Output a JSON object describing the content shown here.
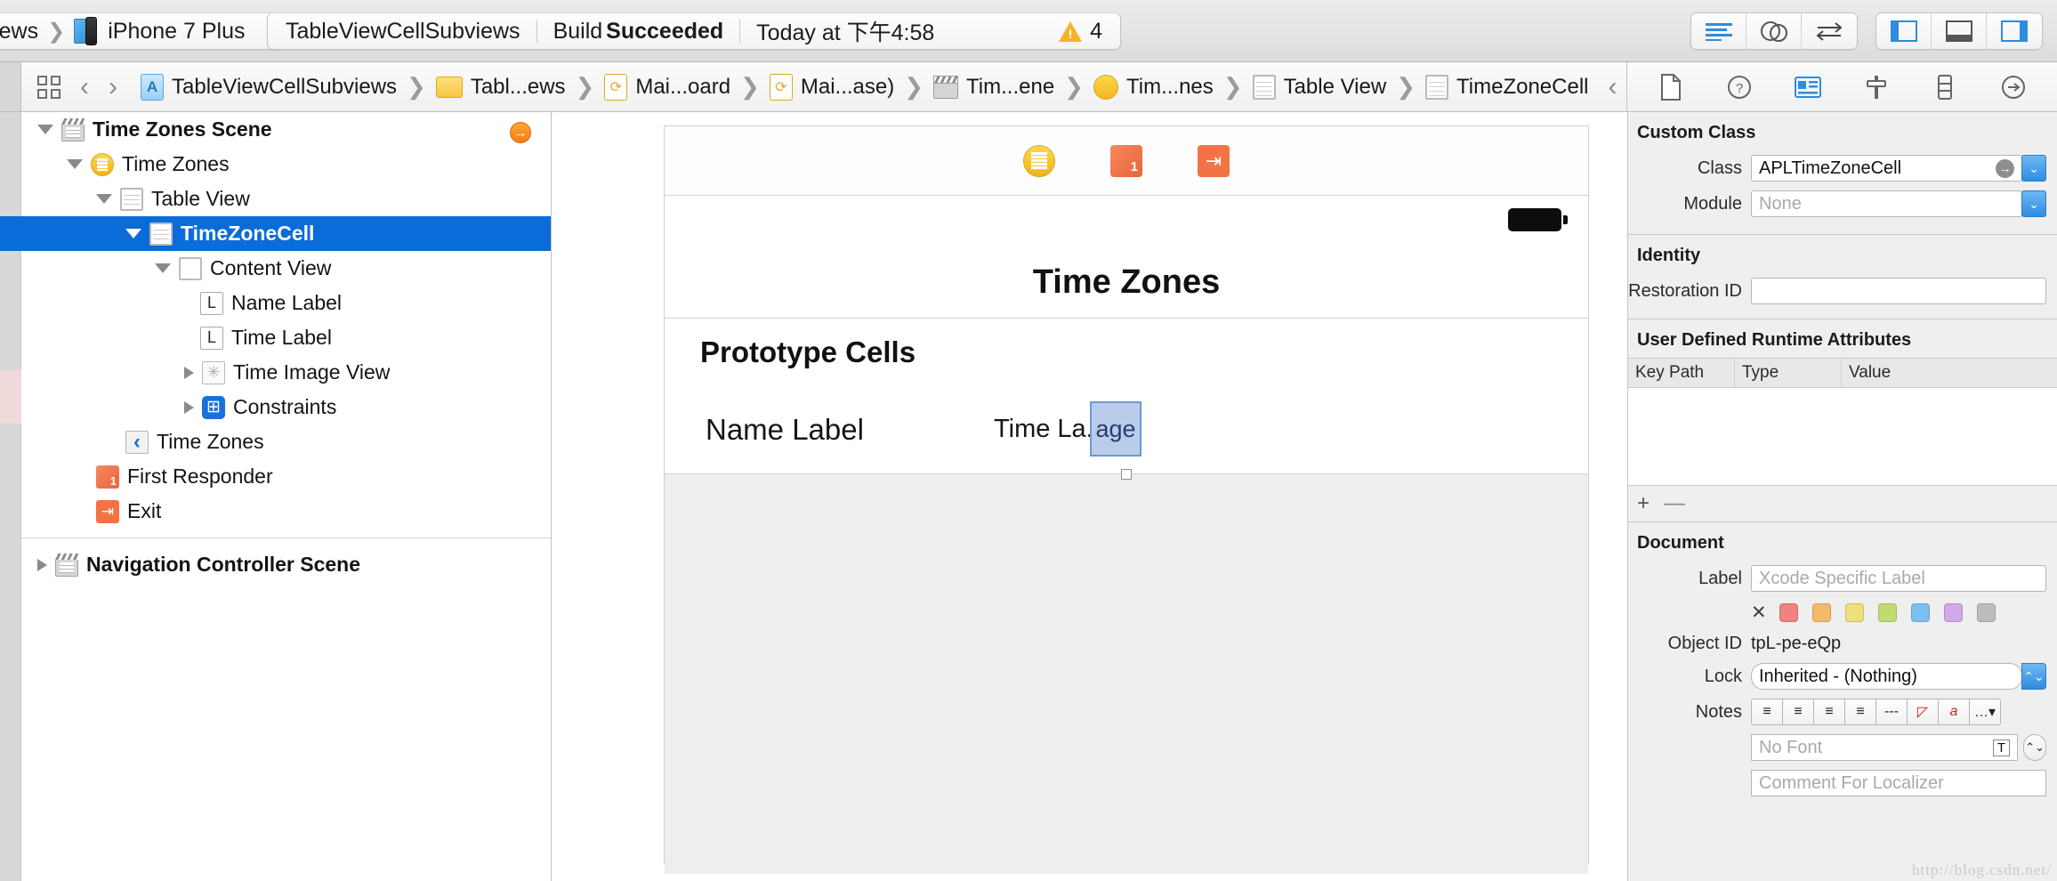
{
  "toolbar": {
    "scheme": {
      "project": "wCellSubviews",
      "destination": "iPhone 7 Plus"
    },
    "status": {
      "project": "TableViewCellSubviews",
      "build_prefix": "Build ",
      "build_result": "Succeeded",
      "timestamp": "Today at 下午4:58",
      "warning_count": "4"
    },
    "editor_buttons": [
      "standard-editor-icon",
      "assistant-editor-icon",
      "version-editor-icon"
    ],
    "view_buttons": [
      "hide-navigator-icon",
      "hide-debug-area-icon",
      "hide-utilities-icon"
    ]
  },
  "jumpbar": {
    "crumbs": [
      {
        "label": "TableViewCellSubviews",
        "icon": "project-icon"
      },
      {
        "label": "Tabl...ews",
        "icon": "folder-icon"
      },
      {
        "label": "Mai...oard",
        "icon": "storyboard-icon"
      },
      {
        "label": "Mai...ase)",
        "icon": "storyboard-icon"
      },
      {
        "label": "Tim...ene",
        "icon": "scene-icon"
      },
      {
        "label": "Tim...nes",
        "icon": "view-controller-icon"
      },
      {
        "label": "Table View",
        "icon": "table-view-icon"
      },
      {
        "label": "TimeZoneCell",
        "icon": "table-cell-icon"
      }
    ]
  },
  "outline": {
    "rows": [
      {
        "label": "Time Zones Scene",
        "icon": "scene-icon",
        "indent": 0,
        "disclosure": "open",
        "bold": true,
        "selected": false
      },
      {
        "label": "Time Zones",
        "icon": "view-controller-icon",
        "indent": 1,
        "disclosure": "open",
        "bold": false,
        "selected": false
      },
      {
        "label": "Table View",
        "icon": "table-view-icon",
        "indent": 2,
        "disclosure": "open",
        "bold": false,
        "selected": false
      },
      {
        "label": "TimeZoneCell",
        "icon": "table-cell-icon",
        "indent": 3,
        "disclosure": "open",
        "bold": true,
        "selected": true
      },
      {
        "label": "Content View",
        "icon": "view-icon",
        "indent": 4,
        "disclosure": "open",
        "bold": false,
        "selected": false
      },
      {
        "label": "Name Label",
        "icon": "label-icon",
        "indent": 5,
        "disclosure": "none",
        "bold": false,
        "selected": false
      },
      {
        "label": "Time Label",
        "icon": "label-icon",
        "indent": 5,
        "disclosure": "none",
        "bold": false,
        "selected": false
      },
      {
        "label": "Time Image View",
        "icon": "image-view-icon",
        "indent": 5,
        "disclosure": "closed",
        "bold": false,
        "selected": false
      },
      {
        "label": "Constraints",
        "icon": "constraints-icon",
        "indent": 5,
        "disclosure": "closed",
        "bold": false,
        "selected": false
      },
      {
        "label": "Time Zones",
        "icon": "back-item-icon",
        "indent": 3,
        "disclosure": "none",
        "bold": false,
        "selected": false
      },
      {
        "label": "First Responder",
        "icon": "first-responder-icon",
        "indent": 2,
        "disclosure": "none",
        "bold": false,
        "selected": false
      },
      {
        "label": "Exit",
        "icon": "exit-icon",
        "indent": 2,
        "disclosure": "none",
        "bold": false,
        "selected": false
      }
    ],
    "footer_row": {
      "label": "Navigation Controller Scene",
      "icon": "scene-icon",
      "disclosure": "closed",
      "bold": true
    }
  },
  "canvas": {
    "scene_dock_icons": [
      "view-controller-icon",
      "first-responder-icon",
      "exit-icon"
    ],
    "nav_title": "Time Zones",
    "prototype_header": "Prototype Cells",
    "cell": {
      "name_label": "Name Label",
      "time_label": "Time La...",
      "image_label": "age"
    }
  },
  "inspector": {
    "tabs": [
      "file-inspector-icon",
      "quick-help-icon",
      "identity-inspector-icon",
      "attributes-inspector-icon",
      "size-inspector-icon",
      "connections-inspector-icon"
    ],
    "custom_class": {
      "title": "Custom Class",
      "class_label": "Class",
      "class_value": "APLTimeZoneCell",
      "module_label": "Module",
      "module_placeholder": "None"
    },
    "identity": {
      "title": "Identity",
      "restoration_label": "Restoration ID",
      "restoration_value": ""
    },
    "runtime_attributes": {
      "title": "User Defined Runtime Attributes",
      "columns": [
        "Key Path",
        "Type",
        "Value"
      ],
      "rows": [],
      "add_label": "+",
      "remove_label": "—"
    },
    "document": {
      "title": "Document",
      "label_label": "Label",
      "label_placeholder": "Xcode Specific Label",
      "swatch_clear": "✕",
      "swatches": [
        "#f0837f",
        "#f3ba6a",
        "#efe07a",
        "#bfdc72",
        "#7cc0f0",
        "#d2a8e8",
        "#bcbcbc"
      ],
      "object_id_label": "Object ID",
      "object_id_value": "tpL-pe-eQp",
      "lock_label": "Lock",
      "lock_value": "Inherited - (Nothing)",
      "notes_label": "Notes",
      "notes_buttons": [
        "align-left-icon",
        "align-center-icon",
        "align-right-icon",
        "align-justify-icon",
        "dashes-icon",
        "no-color-icon",
        "no-font-icon",
        "more-icon"
      ],
      "font_placeholder": "No Font",
      "comment_placeholder": "Comment For Localizer"
    },
    "watermark": "http://blog.csdn.net/"
  },
  "colors": {
    "selection_blue": "#0a6cd8",
    "accent_blue": "#2f8ce0",
    "warning_yellow": "#f5b32c",
    "exit_orange": "#f47244"
  }
}
